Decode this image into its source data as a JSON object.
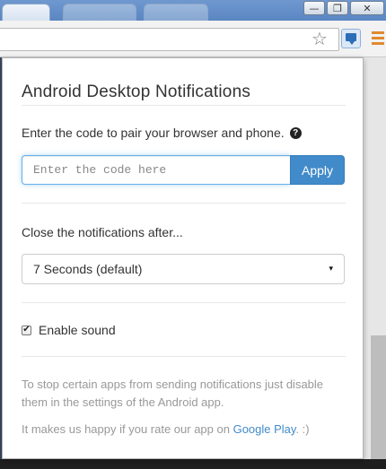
{
  "popup": {
    "title": "Android Desktop Notifications",
    "pair_label": "Enter the code to pair your browser and phone.",
    "help_icon": "?",
    "code_input": {
      "value": "",
      "placeholder": "Enter the code here"
    },
    "apply_label": "Apply",
    "close_label": "Close the notifications after...",
    "select_value": "7 Seconds (default)",
    "caret": "▾",
    "sound_label": "Enable sound",
    "sound_checked": true,
    "checkmark": "✔",
    "note_block": "To stop certain apps from sending notifications just disable them in the settings of the Android app.",
    "rate_prefix": "It makes us happy if you rate our app on ",
    "rate_link": "Google Play",
    "rate_suffix": ". :)",
    "link_color": "#428bca",
    "accent_color": "#428bca"
  },
  "window": {
    "minimize": "—",
    "maximize": "❐",
    "close": "✕"
  },
  "toolbar": {
    "star_icon": "☆",
    "extension_icon": "desktop-notification-icon",
    "menu_icon": "hamburger-menu-icon"
  }
}
